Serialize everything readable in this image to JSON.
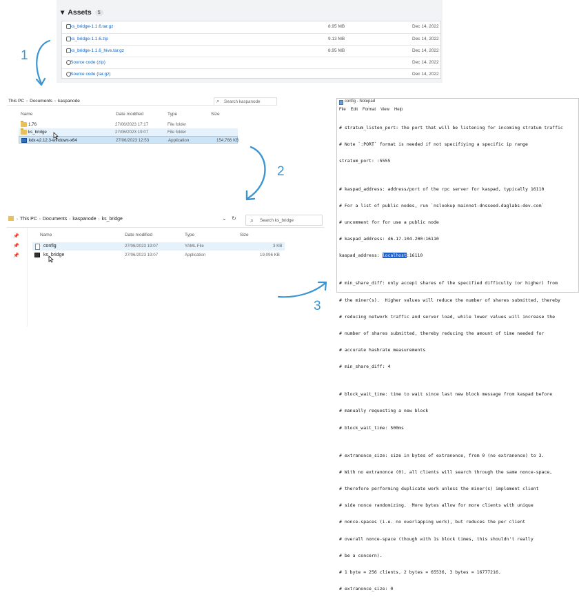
{
  "assets": {
    "title": "Assets",
    "count": "5",
    "items": [
      {
        "name": "ks_bridge-1.1.6.tar.gz",
        "size": "8.95 MB",
        "date": "Dec 14, 2022",
        "icon": "package-icon"
      },
      {
        "name": "ks_bridge-1.1.6.zip",
        "size": "9.13 MB",
        "date": "Dec 14, 2022",
        "icon": "package-icon"
      },
      {
        "name": "ks_bridge-1.1.6_hive.tar.gz",
        "size": "8.95 MB",
        "date": "Dec 14, 2022",
        "icon": "package-icon"
      },
      {
        "name": "Source code (zip)",
        "size": "",
        "date": "Dec 14, 2022",
        "icon": "file-zip-icon"
      },
      {
        "name": "Source code (tar.gz)",
        "size": "",
        "date": "Dec 14, 2022",
        "icon": "file-zip-icon"
      }
    ]
  },
  "explorer1": {
    "path": [
      "This PC",
      "Documents",
      "kaspanode"
    ],
    "search_placeholder": "Search kaspanode",
    "columns": [
      "Name",
      "Date modified",
      "Type",
      "Size"
    ],
    "files": [
      {
        "name": "1.76",
        "date": "27/06/2023 17:17",
        "type": "File folder",
        "size": "",
        "kind": "folder"
      },
      {
        "name": "ks_bridge",
        "date": "27/06/2023 19:07",
        "type": "File folder",
        "size": "",
        "kind": "folder"
      },
      {
        "name": "kdx-v2.12.3-windows-x64",
        "date": "27/06/2023 12:53",
        "type": "Application",
        "size": "154,766 KB",
        "kind": "app"
      }
    ]
  },
  "explorer2": {
    "path": [
      "This PC",
      "Documents",
      "kaspanode",
      "ks_bridge"
    ],
    "search_placeholder": "Search ks_bridge",
    "columns": [
      "Name",
      "Date modified",
      "Type",
      "Size"
    ],
    "files": [
      {
        "name": "config",
        "date": "27/06/2023 19:07",
        "type": "YAML File",
        "size": "3 KB",
        "kind": "config"
      },
      {
        "name": "ks_bridge",
        "date": "27/06/2023 19:07",
        "type": "Application",
        "size": "19,096 KB",
        "kind": "app"
      }
    ]
  },
  "notepad": {
    "title": "config - Notepad",
    "menu": [
      "File",
      "Edit",
      "Format",
      "View",
      "Help"
    ],
    "lines_before": [
      "# stratum_listen_port: the port that will be listening for incoming stratum traffic",
      "# Note `:PORT` format is needed if not specifiying a specific ip range",
      "stratum_port: :5555",
      "",
      "# kaspad_address: address/port of the rpc server for kaspad, typically 16110",
      "# For a list of public nodes, run `nslookup mainnet-dnsseed.daglabs-dev.com`",
      "# uncomment for for use a public node",
      "# kaspad_address: 46.17.104.200:16110"
    ],
    "kaspad_key": "kaspad_address: ",
    "kaspad_host": "localhost",
    "kaspad_port": ":16110",
    "lines_after": [
      "",
      "# min_share_diff: only accept shares of the specified difficulty (or higher) from",
      "# the miner(s).  Higher values will reduce the number of shares submitted, thereby",
      "# reducing network traffic and server load, while lower values will increase the",
      "# number of shares submitted, thereby reducing the amount of time needed for",
      "# accurate hashrate measurements",
      "# min_share_diff: 4",
      "",
      "# block_wait_time: time to wait since last new block message from kaspad before",
      "# manually requesting a new block",
      "# block_wait_time: 500ms",
      "",
      "# extranonce_size: size in bytes of extranonce, from 0 (no extranonce) to 3.",
      "# With no extranonce (0), all clients will search through the same nonce-space,",
      "# therefore performing duplicate work unless the miner(s) implement client",
      "# side nonce randomizing.  More bytes allow for more clients with unique",
      "# nonce-spaces (i.e. no overlapping work), but reduces the per client",
      "# overall nonce-space (though with 1s block times, this shouldn't really",
      "# be a concern).",
      "# 1 byte = 256 clients, 2 bytes = 65536, 3 bytes = 16777216.",
      "# extranonce_size: 0"
    ]
  },
  "annotations": [
    "1",
    "2",
    "3"
  ],
  "colors": {
    "link": "#0b63c8",
    "arrow": "#3a95d2",
    "selection": "#cce4f7",
    "highlight": "#1f5fc8"
  }
}
